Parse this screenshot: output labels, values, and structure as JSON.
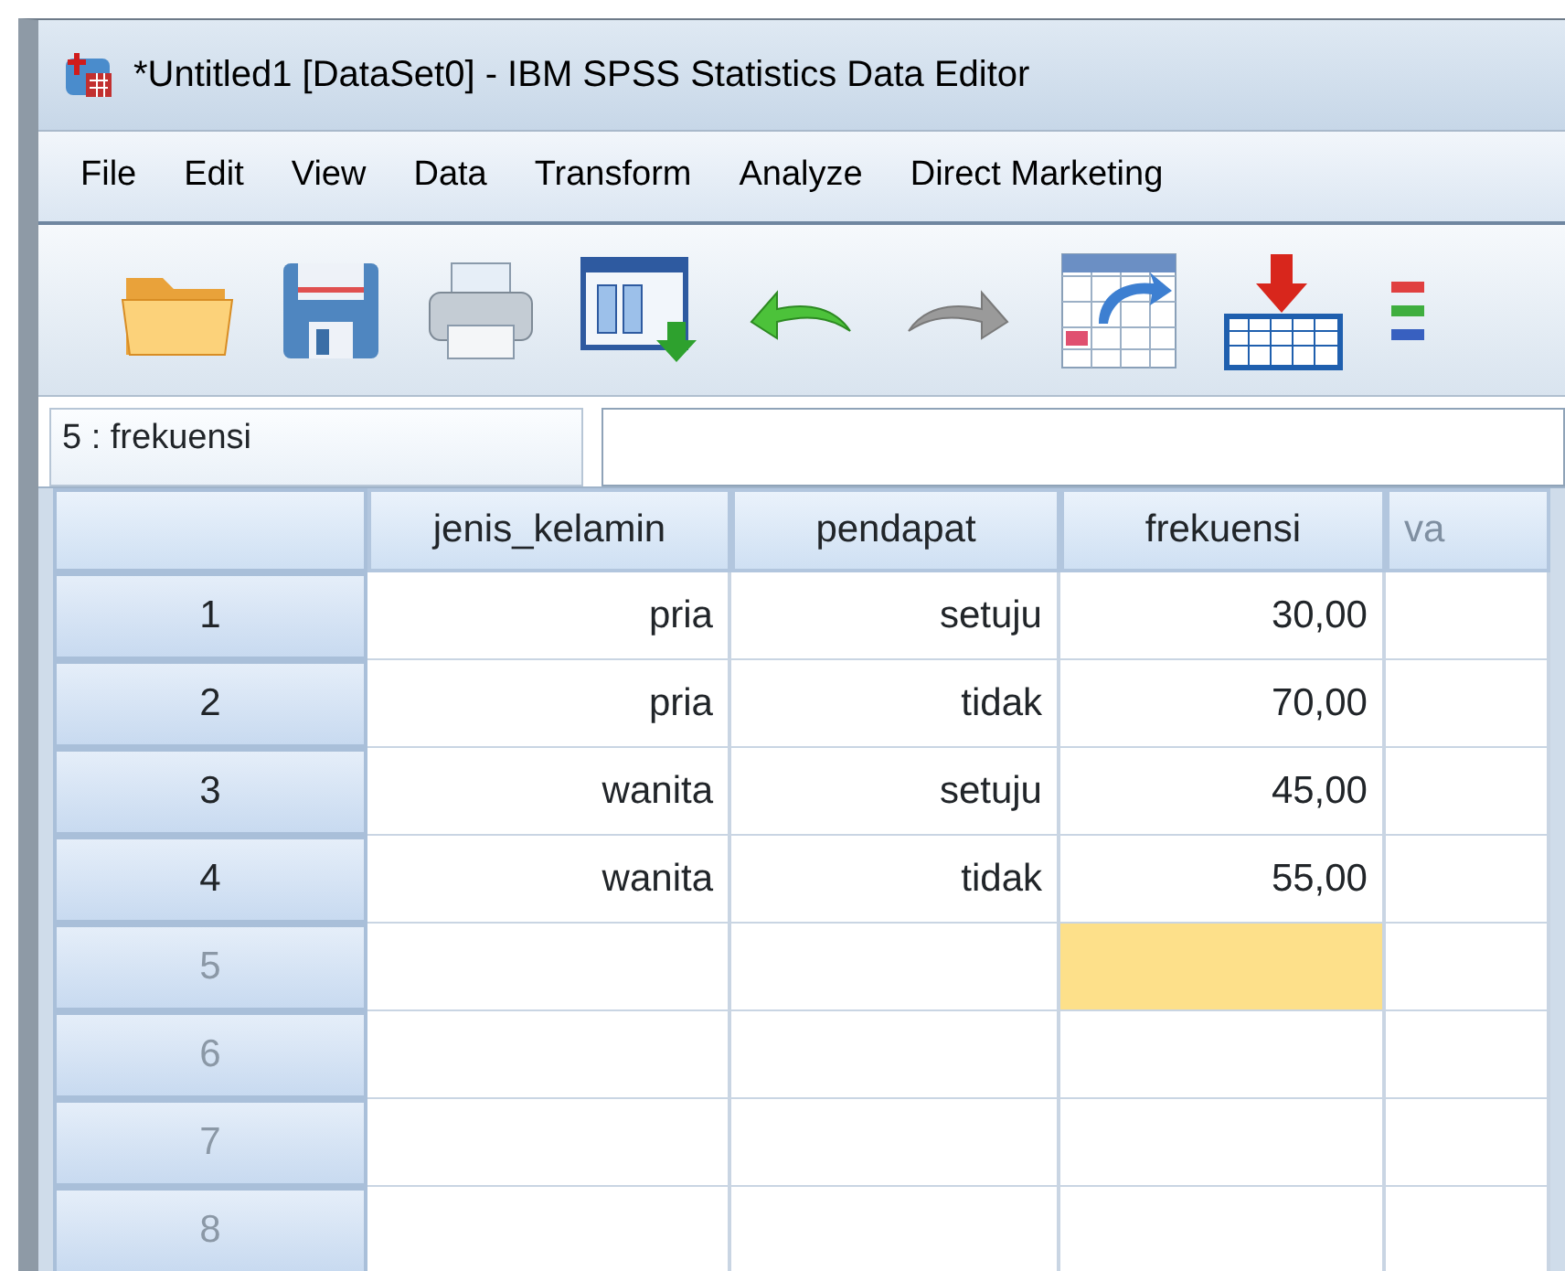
{
  "window": {
    "title": "*Untitled1 [DataSet0] - IBM SPSS Statistics Data Editor"
  },
  "menu": [
    "File",
    "Edit",
    "View",
    "Data",
    "Transform",
    "Analyze",
    "Direct Marketing"
  ],
  "cell_reference": {
    "label": "5 : frekuensi"
  },
  "grid": {
    "columns": [
      "jenis_kelamin",
      "pendapat",
      "frekuensi",
      "va"
    ],
    "rows": [
      {
        "number": "1",
        "has_data": true,
        "cells": [
          {
            "text": "pria",
            "selected": false
          },
          {
            "text": "setuju",
            "selected": false
          },
          {
            "text": "30,00",
            "selected": false
          },
          {
            "selected": false
          }
        ]
      },
      {
        "number": "2",
        "has_data": true,
        "cells": [
          {
            "text": "pria",
            "selected": false
          },
          {
            "text": "tidak",
            "selected": false
          },
          {
            "text": "70,00",
            "selected": false
          },
          {
            "selected": false
          }
        ]
      },
      {
        "number": "3",
        "has_data": true,
        "cells": [
          {
            "text": "wanita",
            "selected": false
          },
          {
            "text": "setuju",
            "selected": false
          },
          {
            "text": "45,00",
            "selected": false
          },
          {
            "selected": false
          }
        ]
      },
      {
        "number": "4",
        "has_data": true,
        "cells": [
          {
            "text": "wanita",
            "selected": false
          },
          {
            "text": "tidak",
            "selected": false
          },
          {
            "text": "55,00",
            "selected": false
          },
          {
            "selected": false
          }
        ]
      },
      {
        "number": "5",
        "has_data": false,
        "cells": [
          {
            "selected": false
          },
          {
            "selected": false
          },
          {
            "selected": true
          },
          {
            "selected": false
          }
        ]
      },
      {
        "number": "6",
        "has_data": false,
        "cells": [
          {
            "selected": false
          },
          {
            "selected": false
          },
          {
            "selected": false
          },
          {
            "selected": false
          }
        ]
      },
      {
        "number": "7",
        "has_data": false,
        "cells": [
          {
            "selected": false
          },
          {
            "selected": false
          },
          {
            "selected": false
          },
          {
            "selected": false
          }
        ]
      },
      {
        "number": "8",
        "has_data": false,
        "cells": [
          {
            "selected": false
          },
          {
            "selected": false
          },
          {
            "selected": false
          },
          {
            "selected": false
          }
        ]
      }
    ]
  }
}
